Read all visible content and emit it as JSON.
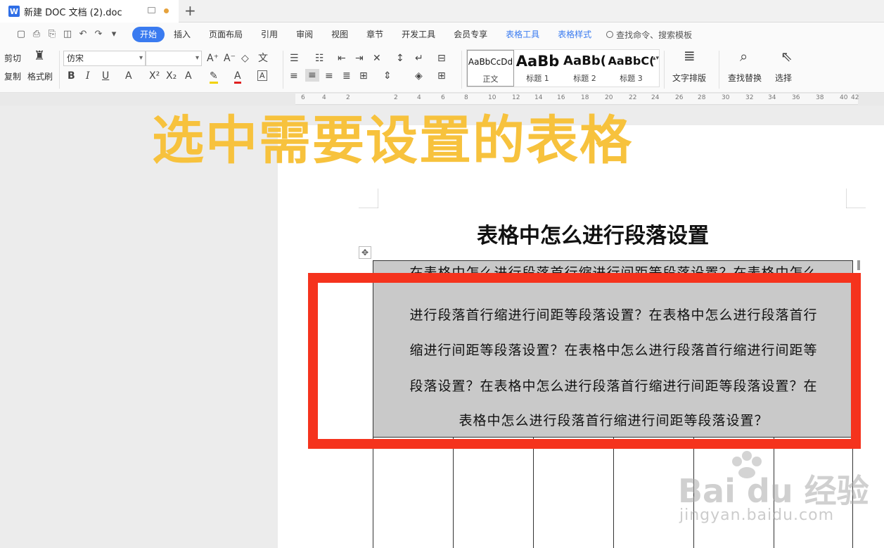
{
  "titlebar": {
    "doc_title": "新建 DOC 文档 (2).doc",
    "new_tab": "+"
  },
  "menu": {
    "tabs": [
      "开始",
      "插入",
      "页面布局",
      "引用",
      "审阅",
      "视图",
      "章节",
      "开发工具",
      "会员专享"
    ],
    "context_tabs": [
      "表格工具",
      "表格样式"
    ],
    "search": "查找命令、搜索模板"
  },
  "ribbon": {
    "cut": "剪切",
    "copy": "复制",
    "format_painter": "格式刷",
    "font": "仿宋",
    "font_size": "",
    "styles": [
      {
        "sample": "AaBbCcDd",
        "name": "正文"
      },
      {
        "sample": "AaBb",
        "name": "标题 1"
      },
      {
        "sample": "AaBb(",
        "name": "标题 2"
      },
      {
        "sample": "AaBbC(",
        "name": "标题 3"
      }
    ],
    "text_layout": "文字排版",
    "find_replace": "查找替换",
    "select": "选择"
  },
  "ruler": [
    "6",
    "4",
    "2",
    "2",
    "4",
    "6",
    "8",
    "10",
    "12",
    "14",
    "16",
    "18",
    "20",
    "22",
    "24",
    "26",
    "28",
    "30",
    "32",
    "34",
    "36",
    "38",
    "40",
    "42"
  ],
  "overlay": {
    "heading": "选中需要设置的表格"
  },
  "document": {
    "title": "表格中怎么进行段落设置",
    "paragraph_lines": [
      "在表格中怎么进行段落首行缩进行间距等段落设置？在表格中怎么",
      "进行段落首行缩进行间距等段落设置？在表格中怎么进行段落首行",
      "缩进行间距等段落设置？在表格中怎么进行段落首行缩进行间距等",
      "段落设置？在表格中怎么进行段落首行缩进行间距等段落设置？在",
      "表格中怎么进行段落首行缩进行间距等段落设置？"
    ]
  },
  "watermark": {
    "logo": "Bai du 经验",
    "url": "jingyan.baidu.com"
  },
  "colors": {
    "accent": "#3a7bf0",
    "overlay_text": "#f7c23d",
    "highlight_box": "#f5331d",
    "selection_fill": "#c9c9c9"
  }
}
